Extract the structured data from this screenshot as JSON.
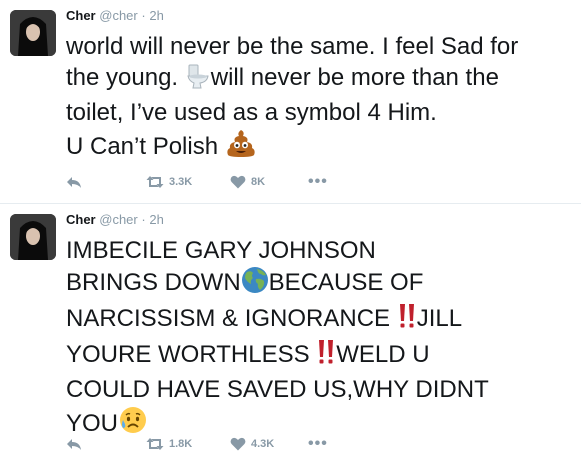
{
  "tweets": [
    {
      "author": "Cher",
      "handle": "@cher",
      "separator": "·",
      "time": "2h",
      "lines": [
        "world will never be the same. I feel Sad for",
        [
          "the young. ",
          "will never be more than the"
        ],
        "toilet, I’ve used as a symbol 4 Him.",
        [
          "U Can’t Polish "
        ]
      ],
      "emojis": [
        "toilet-emoji",
        "pile-of-poo-emoji"
      ],
      "retweets": "3.3K",
      "likes": "8K",
      "more": "•••"
    },
    {
      "author": "Cher",
      "handle": "@cher",
      "separator": "·",
      "time": "2h",
      "lines": [
        "IMBECILE GARY JOHNSON",
        [
          "BRINGS DOWN",
          "BECAUSE OF"
        ],
        [
          "NARCISSISM & IGNORANCE ",
          "JILL"
        ],
        [
          "YOURE WORTHLESS ",
          "WELD U"
        ],
        "COULD HAVE SAVED US,WHY DIDNT",
        [
          "YOU"
        ]
      ],
      "emojis": [
        "earth-globe-emoji",
        "double-exclamation-emoji",
        "double-exclamation-emoji",
        "sad-but-relieved-face-emoji"
      ],
      "retweets": "1.8K",
      "likes": "4.3K",
      "more": "•••"
    }
  ],
  "colors": {
    "text": "#14171a",
    "muted": "#8899a6",
    "divider": "#e6ecf0",
    "exclamation": "#c0202c"
  }
}
